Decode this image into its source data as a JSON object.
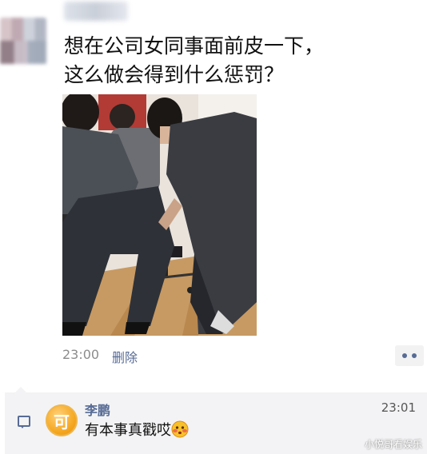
{
  "post": {
    "line1": "想在公司女同事面前皮一下，",
    "line2": "这么做会得到什么惩罚？",
    "time": "23:00",
    "delete_label": "删除"
  },
  "comment": {
    "avatar_char": "可",
    "name": "李鹏",
    "time": "23:01",
    "text": "有本事真戳哎"
  },
  "watermark": "小悦哥看娱乐",
  "icons": [
    "more-icon",
    "comment-icon",
    "blushing-emoji-icon"
  ],
  "colors": {
    "link": "#576b95",
    "comment_bg": "#f3f3f5",
    "time_gray": "#8c8c8c"
  }
}
